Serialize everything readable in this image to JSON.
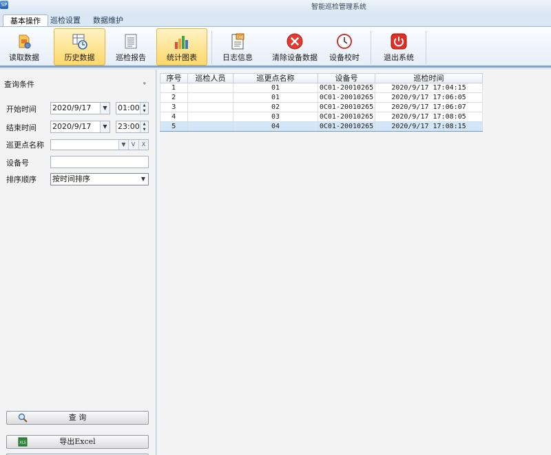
{
  "window": {
    "title": "智能巡检管理系统",
    "app_icon_label": "SP"
  },
  "tabs": [
    "基本操作",
    "巡检设置",
    "数据维护"
  ],
  "ribbon": [
    {
      "label": "读取数据",
      "icon": "read-data-icon"
    },
    {
      "label": "历史数据",
      "icon": "history-data-icon",
      "selected": true
    },
    {
      "label": "巡检报告",
      "icon": "report-icon"
    },
    {
      "label": "统计图表",
      "icon": "chart-icon",
      "selected": true
    },
    {
      "label": "日志信息",
      "icon": "log-icon",
      "badge": "Log"
    },
    {
      "label": "清除设备数据",
      "icon": "clear-data-icon"
    },
    {
      "label": "设备校时",
      "icon": "clock-icon"
    },
    {
      "label": "退出系统",
      "icon": "power-icon"
    }
  ],
  "query": {
    "title": "查询条件",
    "pin_glyph": "ᵩ",
    "start_label": "开始时间",
    "start_date": "2020/9/17",
    "start_time": "01:00",
    "end_label": "结束时间",
    "end_date": "2020/9/17",
    "end_time": "23:00",
    "point_label": "巡更点名称",
    "point_value": "",
    "device_label": "设备号",
    "device_value": "",
    "sort_label": "排序顺序",
    "sort_value": "按时间排序",
    "search_button": "查  询",
    "export_button": "导出Excel",
    "excel_badge": "XLS"
  },
  "grid": {
    "headers": [
      "序号",
      "巡检人员",
      "巡更点名称",
      "设备号",
      "巡检时间"
    ],
    "rows": [
      [
        "1",
        "",
        "01",
        "0C01-20010265",
        "2020/9/17 17:04:15"
      ],
      [
        "2",
        "",
        "01",
        "0C01-20010265",
        "2020/9/17 17:06:05"
      ],
      [
        "3",
        "",
        "02",
        "0C01-20010265",
        "2020/9/17 17:06:07"
      ],
      [
        "4",
        "",
        "03",
        "0C01-20010265",
        "2020/9/17 17:08:05"
      ],
      [
        "5",
        "",
        "04",
        "0C01-20010265",
        "2020/9/17 17:08:15"
      ]
    ],
    "selected_row": 4
  },
  "colors": {
    "accent": "#7fa2cc",
    "selection": "#d3e6f8",
    "ribbon_highlight": "#ffd86a"
  }
}
